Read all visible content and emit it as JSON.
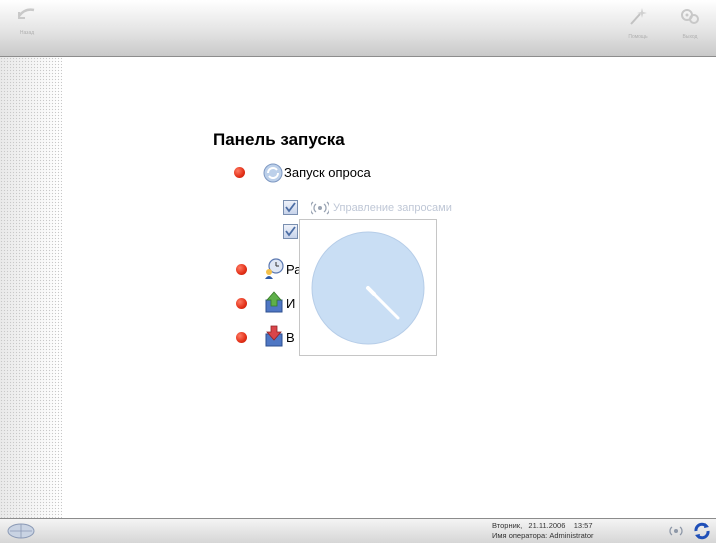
{
  "toolbar": {
    "back_label": "Назад",
    "help_label": "Помощь",
    "exit_label": "Выход"
  },
  "panel": {
    "title": "Панель запуска",
    "items": [
      {
        "label": "Запуск опроса",
        "icon": "refresh-icon"
      },
      {
        "label": "Ра",
        "icon": "clock-person-icon"
      },
      {
        "label": "И",
        "icon": "import-icon"
      },
      {
        "label": "В",
        "icon": "export-icon"
      }
    ],
    "subitems": [
      {
        "label": "Управление запросами",
        "icon": "signal-icon",
        "checked": true
      },
      {
        "label": "",
        "checked": true
      }
    ]
  },
  "status": {
    "day": "Вторник",
    "date": "21.11.2006",
    "time": "13:57",
    "operator_label": "Имя оператора:",
    "operator_name": "Administrator"
  },
  "colors": {
    "bullet": "#e22f17",
    "clock_face": "#c9def4",
    "toolbar": "#e4e4e4"
  }
}
